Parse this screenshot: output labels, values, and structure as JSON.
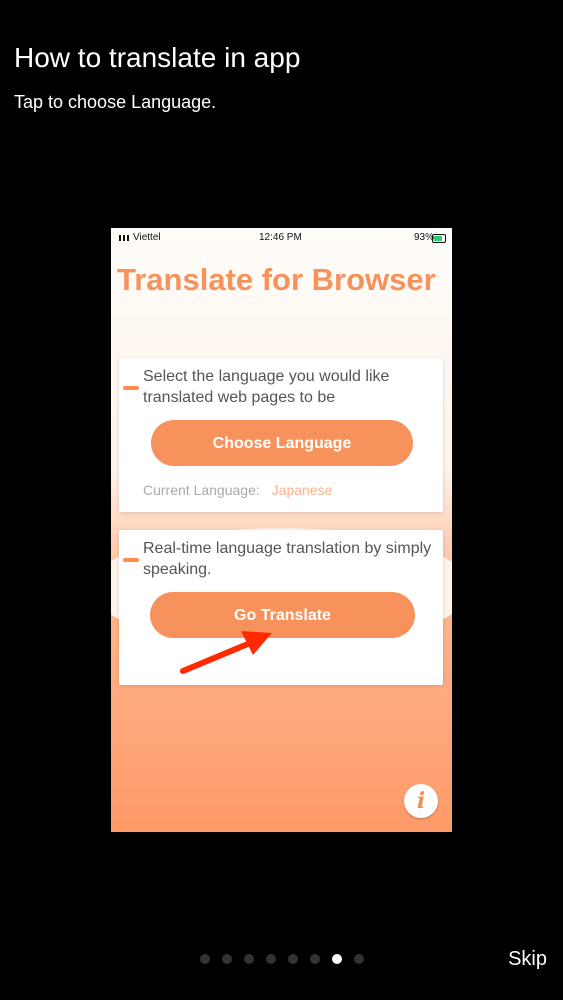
{
  "tutorial": {
    "title": "How to translate in app",
    "subtitle": "Tap to choose Language.",
    "skip_label": "Skip"
  },
  "phone_status": {
    "carrier": "Viettel",
    "time": "12:46 PM",
    "battery": "93%"
  },
  "app": {
    "title": "Translate for Browser",
    "card1": {
      "description": "Select the language you would like translated web pages to be",
      "button_label": "Choose Language",
      "current_label": "Current Language:",
      "current_value": "Japanese"
    },
    "card2": {
      "description": "Real-time language translation by simply speaking.",
      "button_label": "Go Translate"
    },
    "info_icon": "i"
  },
  "pager": {
    "total": 8,
    "active_index": 6
  },
  "colors": {
    "accent": "#f8925c",
    "arrow": "#ff2a00"
  }
}
